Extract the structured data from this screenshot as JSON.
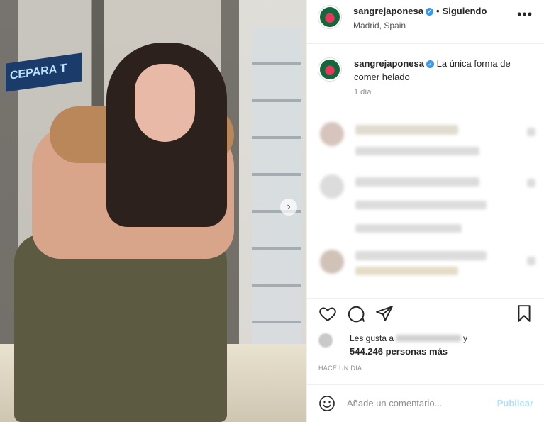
{
  "post": {
    "username": "sangrejaponesa",
    "follow_status": "Siguiendo",
    "location": "Madrid, Spain",
    "more_icon": "more-horizontal-icon",
    "caption_text": "La única forma de comer helado",
    "caption_time": "1 día",
    "likes_prefix": "Les gusta a",
    "likes_suffix": "y",
    "likes_count": "544.246 personas más",
    "posted_ago": "HACE UN DÍA",
    "comment_placeholder": "Añade un comentario...",
    "publish_label": "Publicar",
    "colors": {
      "accent": "#3897f0",
      "publish_disabled": "#b2dffc",
      "text": "#262626",
      "muted": "#8e8e8e"
    }
  },
  "photo": {
    "sign_text": "CEPARA T"
  }
}
